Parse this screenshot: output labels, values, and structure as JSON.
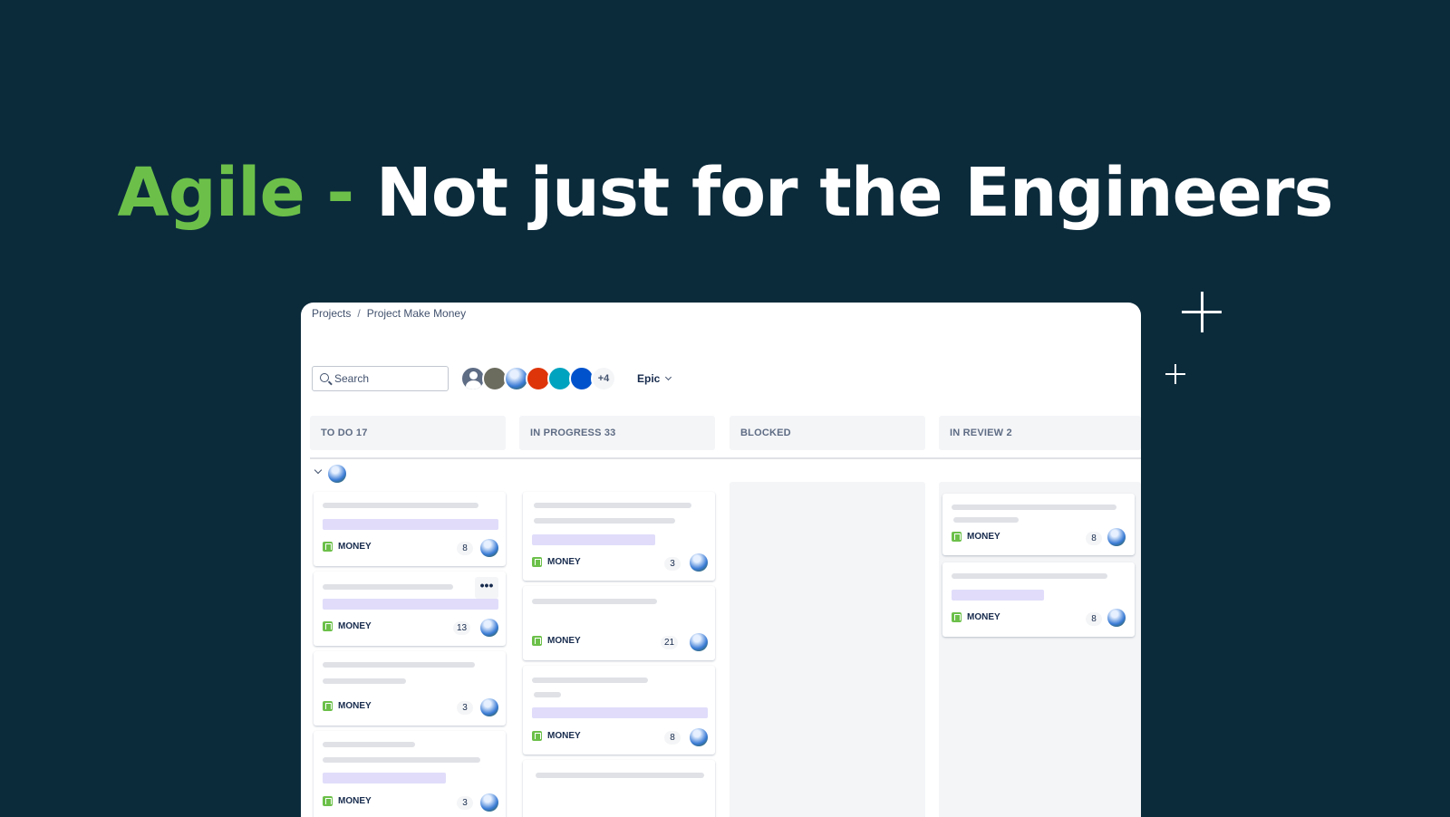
{
  "headline": {
    "accent": "Agile -",
    "rest": "Not just for the Engineers"
  },
  "breadcrumb": {
    "root": "Projects",
    "separator": "/",
    "project": "Project Make Money"
  },
  "search": {
    "placeholder": "Search"
  },
  "avatars": {
    "colors": [
      "#5e6c84",
      "#6b6b5e",
      "#2e6fbd",
      "#de350b",
      "#00a3bf",
      "#0052cc"
    ],
    "more": "+4"
  },
  "filter": {
    "epic_label": "Epic"
  },
  "columns": [
    {
      "label": "TO DO 17"
    },
    {
      "label": "IN PROGRESS 33"
    },
    {
      "label": "BLOCKED"
    },
    {
      "label": "IN REVIEW  2"
    }
  ],
  "card_tag": "MONEY",
  "cards": {
    "todo": [
      "8",
      "13",
      "3",
      "3"
    ],
    "inprogress": [
      "3",
      "21",
      "8"
    ],
    "review": [
      "8",
      "8"
    ]
  },
  "more_button": "•••"
}
